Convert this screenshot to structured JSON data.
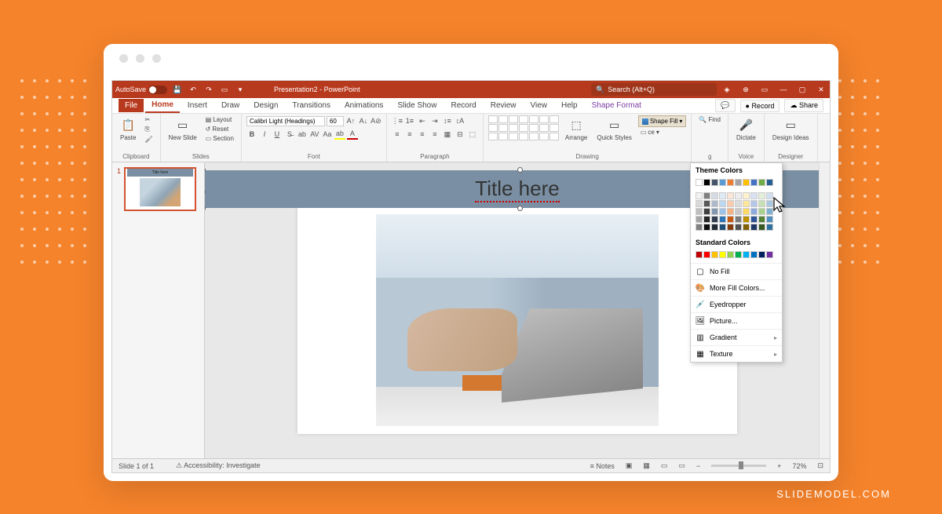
{
  "watermark": "SLIDEMODEL.COM",
  "titlebar": {
    "autosave": "AutoSave",
    "title": "Presentation2 - PowerPoint",
    "search_placeholder": "Search (Alt+Q)"
  },
  "ribbon": {
    "tabs": {
      "file": "File",
      "home": "Home",
      "insert": "Insert",
      "draw": "Draw",
      "design": "Design",
      "transitions": "Transitions",
      "animations": "Animations",
      "slideshow": "Slide Show",
      "record": "Record",
      "review": "Review",
      "view": "View",
      "help": "Help",
      "shape_format": "Shape Format"
    },
    "top_right": {
      "comments": "",
      "record_btn": "Record",
      "share_btn": "Share"
    },
    "groups": {
      "clipboard": {
        "label": "Clipboard",
        "paste": "Paste"
      },
      "slides": {
        "label": "Slides",
        "new_slide": "New\nSlide",
        "layout": "Layout",
        "reset": "Reset",
        "section": "Section"
      },
      "font": {
        "label": "Font",
        "family": "Calibri Light (Headings)",
        "size": "60"
      },
      "paragraph": {
        "label": "Paragraph"
      },
      "drawing": {
        "label": "Drawing",
        "arrange": "Arrange",
        "quick_styles": "Quick\nStyles",
        "shape_fill": "Shape Fill",
        "replace": "ce",
        "find": "Find",
        "editing_label": "g"
      },
      "voice": {
        "label": "Voice",
        "dictate": "Dictate"
      },
      "designer": {
        "label": "Designer",
        "ideas": "Design\nIdeas"
      }
    }
  },
  "thumbnail": {
    "number": "1",
    "title": "Title here"
  },
  "slide": {
    "title": "Title here"
  },
  "color_dropdown": {
    "theme_title": "Theme Colors",
    "standard_title": "Standard Colors",
    "no_fill": "No Fill",
    "more_colors": "More Fill Colors...",
    "eyedropper": "Eyedropper",
    "picture": "Picture...",
    "gradient": "Gradient",
    "texture": "Texture",
    "theme_row": [
      "#ffffff",
      "#000000",
      "#44546a",
      "#5b9bd5",
      "#ed7d31",
      "#a5a5a5",
      "#ffc000",
      "#4472c4",
      "#70ad47",
      "#255e91"
    ],
    "tint_rows": [
      [
        "#f2f2f2",
        "#808080",
        "#d6dce5",
        "#deebf7",
        "#fbe5d6",
        "#ededed",
        "#fff2cc",
        "#d9e2f3",
        "#e2efda",
        "#d0e0f0"
      ],
      [
        "#d9d9d9",
        "#595959",
        "#adb9ca",
        "#bdd7ee",
        "#f8cbad",
        "#dbdbdb",
        "#ffe699",
        "#b4c7e7",
        "#c5e0b4",
        "#a8c8e0"
      ],
      [
        "#bfbfbf",
        "#404040",
        "#8497b0",
        "#9dc3e6",
        "#f4b183",
        "#c9c9c9",
        "#ffd966",
        "#8faadc",
        "#a9d18e",
        "#80b0d0"
      ],
      [
        "#a6a6a6",
        "#262626",
        "#333f50",
        "#2e75b6",
        "#c55a11",
        "#7b7b7b",
        "#bf9000",
        "#2f5597",
        "#548235",
        "#5090c0"
      ],
      [
        "#808080",
        "#0d0d0d",
        "#222a35",
        "#1f4e79",
        "#843c0c",
        "#525252",
        "#806000",
        "#203864",
        "#385723",
        "#3070a0"
      ]
    ],
    "standard_row": [
      "#c00000",
      "#ff0000",
      "#ffc000",
      "#ffff00",
      "#92d050",
      "#00b050",
      "#00b0f0",
      "#0070c0",
      "#002060",
      "#7030a0"
    ]
  },
  "statusbar": {
    "slide_info": "Slide 1 of 1",
    "lang": "",
    "accessibility": "Accessibility: Investigate",
    "notes": "Notes",
    "zoom": "72%"
  }
}
